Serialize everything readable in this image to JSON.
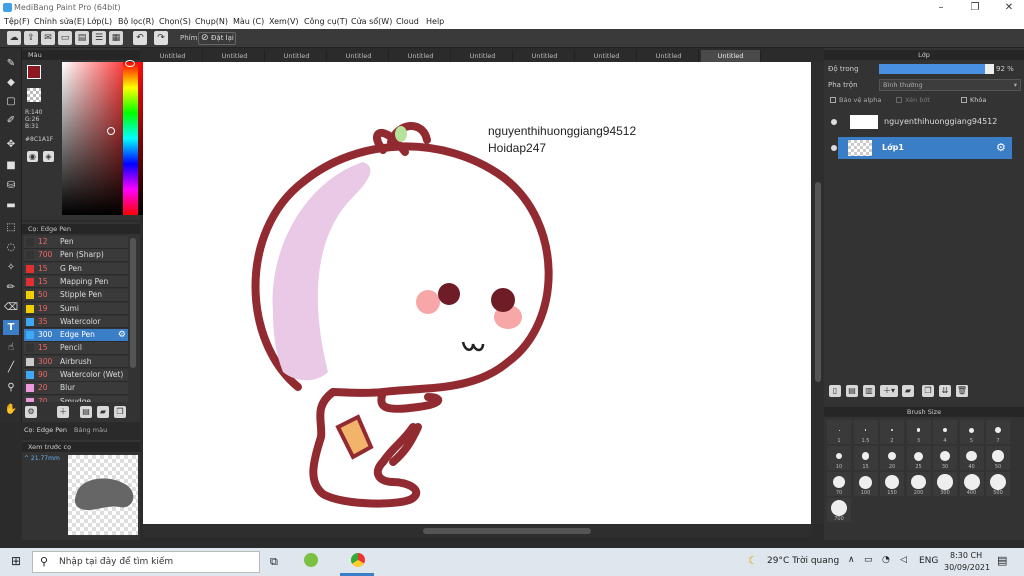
{
  "app": {
    "title": "MediBang Paint Pro (64bit)"
  },
  "menu": [
    "Tệp(F)",
    "Chỉnh sửa(E)",
    "Lớp(L)",
    "Bộ lọc(R)",
    "Chọn(S)",
    "Chụp(N)",
    "Màu (C)",
    "Xem(V)",
    "Công cụ(T)",
    "Cửa sổ(W)",
    "Cloud",
    "Help"
  ],
  "toolbar": {
    "mode_label": "Phím",
    "reset_label": "Đặt lại"
  },
  "color_panel": {
    "title": "Màu",
    "r": "R:140",
    "g": "G:26",
    "b": "B:31",
    "hex": "#8C1A1F",
    "fg_color": "#8C1A1F"
  },
  "brush_panel": {
    "title": "Cọ: Edge Pen",
    "items": [
      {
        "size": "12",
        "name": "Pen",
        "color": "#333333"
      },
      {
        "size": "700",
        "name": "Pen (Sharp)",
        "color": "#333333"
      },
      {
        "size": "15",
        "name": "G Pen",
        "color": "#e03030"
      },
      {
        "size": "15",
        "name": "Mapping Pen",
        "color": "#e03030"
      },
      {
        "size": "50",
        "name": "Stipple Pen",
        "color": "#f0d000"
      },
      {
        "size": "19",
        "name": "Sumi",
        "color": "#f0d000"
      },
      {
        "size": "35",
        "name": "Watercolor",
        "color": "#3fa9f5"
      },
      {
        "size": "300",
        "name": "Edge Pen",
        "color": "#3fa9f5"
      },
      {
        "size": "15",
        "name": "Pencil",
        "color": "#333333"
      },
      {
        "size": "300",
        "name": "Airbrush",
        "color": "#cccccc"
      },
      {
        "size": "90",
        "name": "Watercolor (Wet)",
        "color": "#3fa9f5"
      },
      {
        "size": "20",
        "name": "Blur",
        "color": "#ee99dd"
      },
      {
        "size": "70",
        "name": "Smudge",
        "color": "#ee99dd"
      }
    ],
    "selected_index": 7
  },
  "brush_tabs": {
    "tab1": "Cọ: Edge Pen",
    "tab2": "Bảng màu"
  },
  "preview": {
    "title": "Xem trước cọ",
    "size": "^ 21.77mm"
  },
  "tabs": [
    "Untitled",
    "Untitled",
    "Untitled",
    "Untitled",
    "Untitled",
    "Untitled",
    "Untitled",
    "Untitled",
    "Untitled",
    "Untitled"
  ],
  "canvas_text": {
    "line1": "nguyenthihuonggiang94512",
    "line2": "Hoidap247"
  },
  "layer_panel": {
    "title": "Lớp",
    "opacity_label": "Độ trong",
    "opacity_value": "92 %",
    "opacity_fraction": 0.92,
    "blend_label": "Pha trộn",
    "blend_value": "Bình thường",
    "protect_alpha": "Bảo vệ alpha",
    "clipping": "Xén bớt",
    "lock": "Khóa",
    "layers": [
      {
        "name": "nguyenthihuonggiang94512",
        "selected": false
      },
      {
        "name": "Lớp1",
        "selected": true
      }
    ]
  },
  "brush_size": {
    "title": "Brush Size",
    "sizes": [
      "1",
      "1.5",
      "2",
      "3",
      "4",
      "5",
      "7",
      "10",
      "15",
      "20",
      "25",
      "30",
      "40",
      "50",
      "70",
      "100",
      "150",
      "200",
      "300",
      "400",
      "500",
      "700"
    ]
  },
  "taskbar": {
    "search_placeholder": "Nhập tại đây để tìm kiếm",
    "weather": "29°C  Trời quang",
    "lang": "ENG",
    "time": "8:30 CH",
    "date": "30/09/2021"
  }
}
